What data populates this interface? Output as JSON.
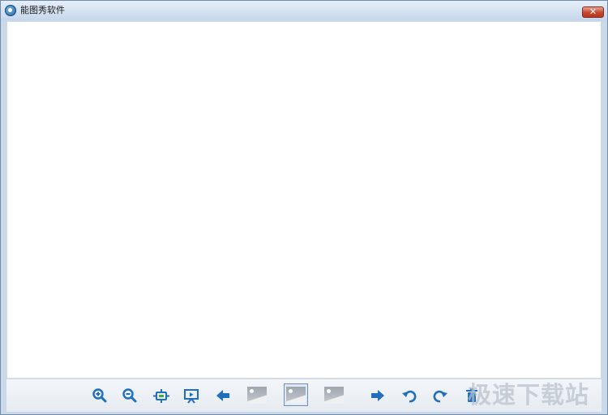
{
  "window": {
    "title": "能图秀软件",
    "close_label": "✕"
  },
  "toolbar": {
    "buttons": [
      {
        "name": "zoom-in-button",
        "icon": "zoom-in-icon"
      },
      {
        "name": "zoom-out-button",
        "icon": "zoom-out-icon"
      },
      {
        "name": "actual-size-button",
        "icon": "actual-size-icon"
      },
      {
        "name": "slideshow-button",
        "icon": "slideshow-icon"
      },
      {
        "name": "previous-button",
        "icon": "arrow-left-icon"
      },
      {
        "name": "next-button",
        "icon": "arrow-right-icon"
      },
      {
        "name": "rotate-left-button",
        "icon": "rotate-left-icon"
      },
      {
        "name": "rotate-right-button",
        "icon": "rotate-right-icon"
      },
      {
        "name": "delete-button",
        "icon": "delete-icon"
      }
    ],
    "thumbnails": [
      {
        "name": "thumbnail-previous",
        "active": false
      },
      {
        "name": "thumbnail-current",
        "active": true
      },
      {
        "name": "thumbnail-next",
        "active": false
      }
    ],
    "accent_color": "#1f6fbd"
  },
  "watermark": {
    "text": "极速下载站"
  }
}
